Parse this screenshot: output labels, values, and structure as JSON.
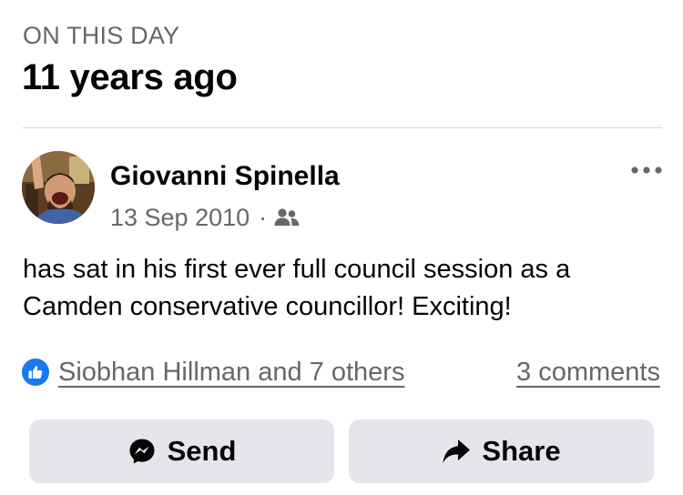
{
  "memory": {
    "label": "ON THIS DAY",
    "title": "11 years ago"
  },
  "post": {
    "author": "Giovanni Spinella",
    "date": "13 Sep 2010",
    "separator": "·",
    "audience_icon": "friends-icon",
    "text": "has sat in his first ever full council session as a Camden conservative councillor! Exciting!"
  },
  "engagement": {
    "reaction_icon": "like-icon",
    "reactors": "Siobhan Hillman and 7 others",
    "comments": "3 comments"
  },
  "actions": {
    "send_label": "Send",
    "share_label": "Share"
  },
  "colors": {
    "secondary_text": "#65676b",
    "primary_text": "#050505",
    "accent_blue": "#1877f2",
    "button_bg": "#e4e6eb"
  }
}
